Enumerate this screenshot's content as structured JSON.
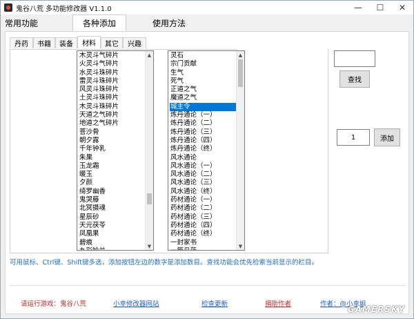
{
  "window": {
    "title": "鬼谷八荒 多功能修改器  V1.1.0",
    "controls": {
      "minimize": "—",
      "maximize": "☐",
      "close": "✕"
    }
  },
  "main_tabs": [
    "常用功能",
    "各种添加",
    "使用方法"
  ],
  "sub_tabs": [
    "丹药",
    "书籍",
    "装备",
    "材料",
    "其它",
    "兴趣"
  ],
  "left_list": [
    "木灵斗气碎片",
    "火灵斗气碎片",
    "水灵斗珠碎片",
    "雷灵斗珠碎片",
    "风灵斗珠碎片",
    "土灵斗珠碎片",
    "木灵斗珠碎片",
    "天道之气碎片",
    "地道之气碎片",
    "菩沙骨",
    "朝夕露",
    "千年钟乳",
    "朱果",
    "玉龙霜",
    "暖玉",
    "夕颜",
    "绮罗幽香",
    "鬼哭藤",
    "北冥摄魂",
    "星辰砂",
    "天元茯苓",
    "凤凰果",
    "碧痕",
    "九彩铃兰"
  ],
  "right_list": [
    "灵石",
    "宗门贡献",
    "生气",
    "死气",
    "正道之气",
    "魔道之气",
    "城主令",
    "炼丹通论（一）",
    "炼丹通论（二）",
    "炼丹通论（三）",
    "炼丹通论（四）",
    "炼丹通论（终）",
    "风水通论",
    "风水通论（一）",
    "风水通论（二）",
    "风水通论（三）",
    "风水通论（终）",
    "药材通论（一）",
    "药材通论（二）",
    "药材通论（三）",
    "药材通论（四）",
    "药材通论（终）",
    "一封家书",
    "一箱丹药"
  ],
  "right_selected": "城主令",
  "search": {
    "value": "",
    "button": "查找"
  },
  "add": {
    "quantity": "1",
    "button": "添加"
  },
  "hint": "可用鼠标、Ctrl键、Shift键多选，添加按钮左边的数字是添加数目。查找功能会优先检索当前显示的栏目。",
  "footer": {
    "game_status": "请运行游戏：鬼谷八荒",
    "website": "小幸修改器网站",
    "check_update": "检查更新",
    "donate": "捐助作者",
    "author": "作者：@小幸姐"
  },
  "watermark": "GAMERSKY",
  "colors": {
    "selection": "#0078d7",
    "link_blue": "#1e5ec8",
    "status_red": "#c62828",
    "hint_blue": "#1e6fd0"
  }
}
